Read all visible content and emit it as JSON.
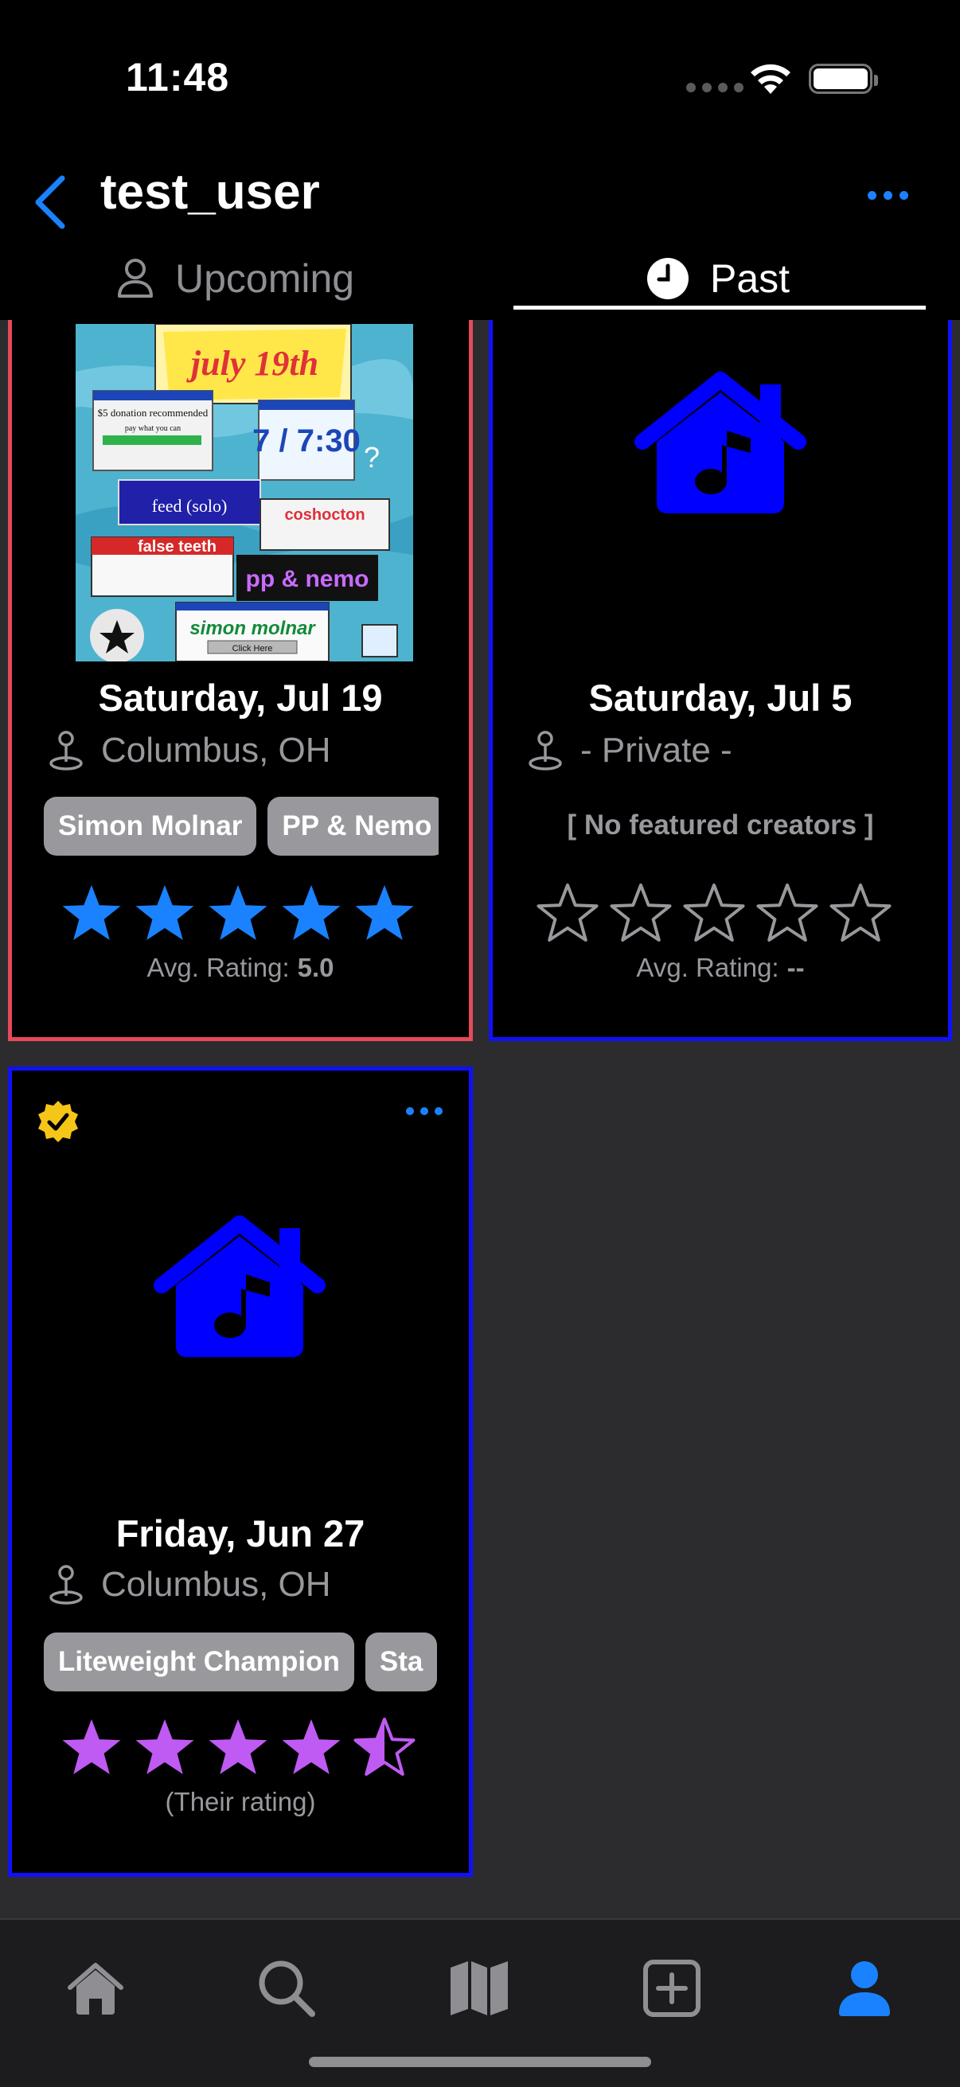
{
  "status_bar": {
    "time": "11:48"
  },
  "header": {
    "title": "test_user"
  },
  "tabs": [
    {
      "label": "Upcoming",
      "active": false
    },
    {
      "label": "Past",
      "active": true
    }
  ],
  "cards": [
    {
      "date": "Saturday, Jul 19",
      "location": "Columbus, OH",
      "chips": [
        "Simon Molnar",
        "PP & Nemo"
      ],
      "stars_filled": 5,
      "star_color": "#1a82ff",
      "rating_label": "Avg. Rating:",
      "rating_value": "5.0",
      "border_color": "#e8485a",
      "poster_text": {
        "date_banner": "july 19th",
        "donation": "$5 donation recommended",
        "pay": "pay what you can",
        "time": "7 / 7:30",
        "act1": "feed (solo)",
        "act2": "coshocton",
        "act3": "false teeth",
        "act4": "pp & nemo",
        "act5": "simon molnar",
        "click": "Click Here"
      }
    },
    {
      "date": "Saturday, Jul 5",
      "location": "- Private -",
      "no_creators": "[ No featured creators ]",
      "stars_filled": 0,
      "rating_label": "Avg. Rating:",
      "rating_value": "--",
      "border_color": "#1010ff"
    },
    {
      "date": "Friday, Jun 27",
      "location": "Columbus, OH",
      "chips": [
        "Liteweight Champion",
        "Sta"
      ],
      "stars_filled": 4.5,
      "star_color": "#bf5af2",
      "rating_note": "(Their rating)",
      "border_color": "#1010ff",
      "verified": true
    }
  ],
  "tabbar": [
    "home-icon",
    "search-icon",
    "map-icon",
    "add-icon",
    "profile-icon"
  ],
  "colors": {
    "accent": "#1a82ff",
    "house_blue": "#0000ff",
    "verified_yellow": "#f5c518"
  }
}
